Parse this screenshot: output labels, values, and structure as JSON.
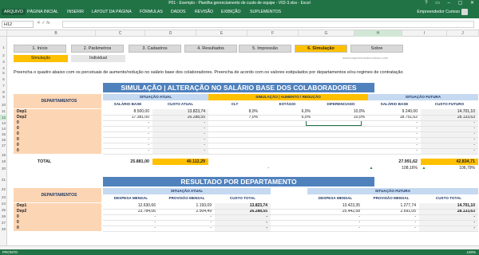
{
  "window": {
    "title": "P01 - Exemplo - Planilha gerenciamento de custo de equipe - V02-3.xlsx - Excel",
    "controls": "?  ▭  –  ▢  ✕"
  },
  "ribbon": {
    "tabs": [
      "ARQUIVO",
      "PÁGINA INICIAL",
      "INSERIR",
      "LAYOUT DA PÁGINA",
      "FÓRMULAS",
      "DADOS",
      "REVISÃO",
      "EXIBIÇÃO",
      "SUPLEMENTOS"
    ],
    "user": "Empreendedor Curioso"
  },
  "formula": {
    "namebox": "H12",
    "fx": "✕  ✓  fx",
    "content": ""
  },
  "columns": [
    "B",
    "C",
    "D",
    "E",
    "F",
    "G",
    "H",
    "I",
    "J"
  ],
  "selected_column": "H",
  "rows": [
    "1",
    "2",
    "3",
    "4",
    "5",
    "6",
    "7",
    "8",
    "9",
    "10",
    "11",
    "12",
    "13",
    "14",
    "15",
    "16",
    "17",
    "18",
    "19",
    "20",
    "21",
    "22",
    "23",
    "24",
    "25",
    "26",
    "27",
    "28"
  ],
  "selected_row": "12",
  "nav": [
    "1. Início",
    "2. Parâmetros",
    "3. Cadastros",
    "4. Resultados",
    "5. Impressão",
    "6. Simulação",
    "Sobre"
  ],
  "active_nav": "6. Simulação",
  "subnav": [
    "Simulação",
    "Individual"
  ],
  "site": "www.empreendedorcurioso.com",
  "instruction": "Preencha o quadro abaixo com os percetuais de aumento/redução no salário base dos colaboradores. Preencha de acordo com os valores estipulados por departamentos e/ou regimes de contratação",
  "sim": {
    "banner": "SIMULAÇÃO | ALTERAÇÃO NO SALÁRIO BASE DOS COLABORADORES",
    "dept_header": "DEPARTAMENTOS",
    "group_atual": "SITUAÇÃO ATUAL",
    "group_sim": "SIMULAÇÃO | AUMENTO / REDUÇÃO",
    "group_futura": "SITUAÇÃO FUTURA",
    "sub": [
      "SALÁRIO BASE",
      "CUSTO ATUAL",
      "CLT",
      "ESTÁGIO",
      "DIFERENCIADO",
      "SALÁRIO BASE",
      "CUSTO FUTURO"
    ],
    "rows": [
      {
        "name": "Dep1",
        "vals": [
          "8.500,00",
          "13.823,74",
          "8,0%",
          "6,0%",
          "10,0%",
          "9.240,00",
          "14.701,10"
        ]
      },
      {
        "name": "Dep2",
        "vals": [
          "17.381,00",
          "26.288,55",
          "7,0%",
          "6,0%",
          "10,0%",
          "18.751,62",
          "28.133,63"
        ]
      },
      {
        "name": "0",
        "vals": [
          "-",
          "-",
          "",
          "",
          "",
          "-",
          "-"
        ]
      },
      {
        "name": "0",
        "vals": [
          "-",
          "-",
          "",
          "",
          "",
          "-",
          "-"
        ]
      },
      {
        "name": "0",
        "vals": [
          "-",
          "-",
          "",
          "",
          "",
          "-",
          "-"
        ]
      },
      {
        "name": "0",
        "vals": [
          "-",
          "-",
          "",
          "",
          "",
          "-",
          "-"
        ]
      },
      {
        "name": "0",
        "vals": [
          "-",
          "-",
          "",
          "",
          "",
          "-",
          "-"
        ]
      },
      {
        "name": "0",
        "vals": [
          "-",
          "-",
          "",
          "",
          "",
          "-",
          "-"
        ]
      }
    ],
    "total_label": "TOTAL",
    "total": [
      "25.881,00",
      "40.112,29",
      "27.991,62",
      "42.834,71"
    ],
    "pct_dash": "-",
    "pct": [
      "108,16%",
      "106,79%"
    ],
    "arrow": "▲"
  },
  "res": {
    "banner": "RESULTADO POR DEPARTAMENTO",
    "dept_header": "DEPARTAMENTOS",
    "group_atual": "SITUAÇÃO ATUAL",
    "group_futura": "SITUAÇÃO FUTURA",
    "sub": [
      "DESPESA MENSAL",
      "PROVISÃO MENSAL",
      "CUSTO TOTAL",
      "DESPESA MENSAL",
      "PROVISÃO MENSAL",
      "CUSTO TOTAL"
    ],
    "rows": [
      {
        "name": "Dep1",
        "vals": [
          "12.630,66",
          "1.193,09",
          "13.823,74",
          "13.423,35",
          "1.277,74",
          "14.701,10"
        ]
      },
      {
        "name": "Dep2",
        "vals": [
          "23.784,06",
          "2.504,49",
          "26.288,55",
          "25.442,58",
          "2.691,05",
          "28.133,63"
        ]
      },
      {
        "name": "0",
        "vals": [
          "-",
          "-",
          "-",
          "-",
          "-",
          "-"
        ]
      },
      {
        "name": "0",
        "vals": [
          "-",
          "-",
          "-",
          "-",
          "-",
          "-"
        ]
      },
      {
        "name": "0",
        "vals": [
          "-",
          "-",
          "-",
          "-",
          "-",
          "-"
        ]
      }
    ]
  },
  "status": {
    "left": "PRONTO",
    "zoom": "100%"
  }
}
